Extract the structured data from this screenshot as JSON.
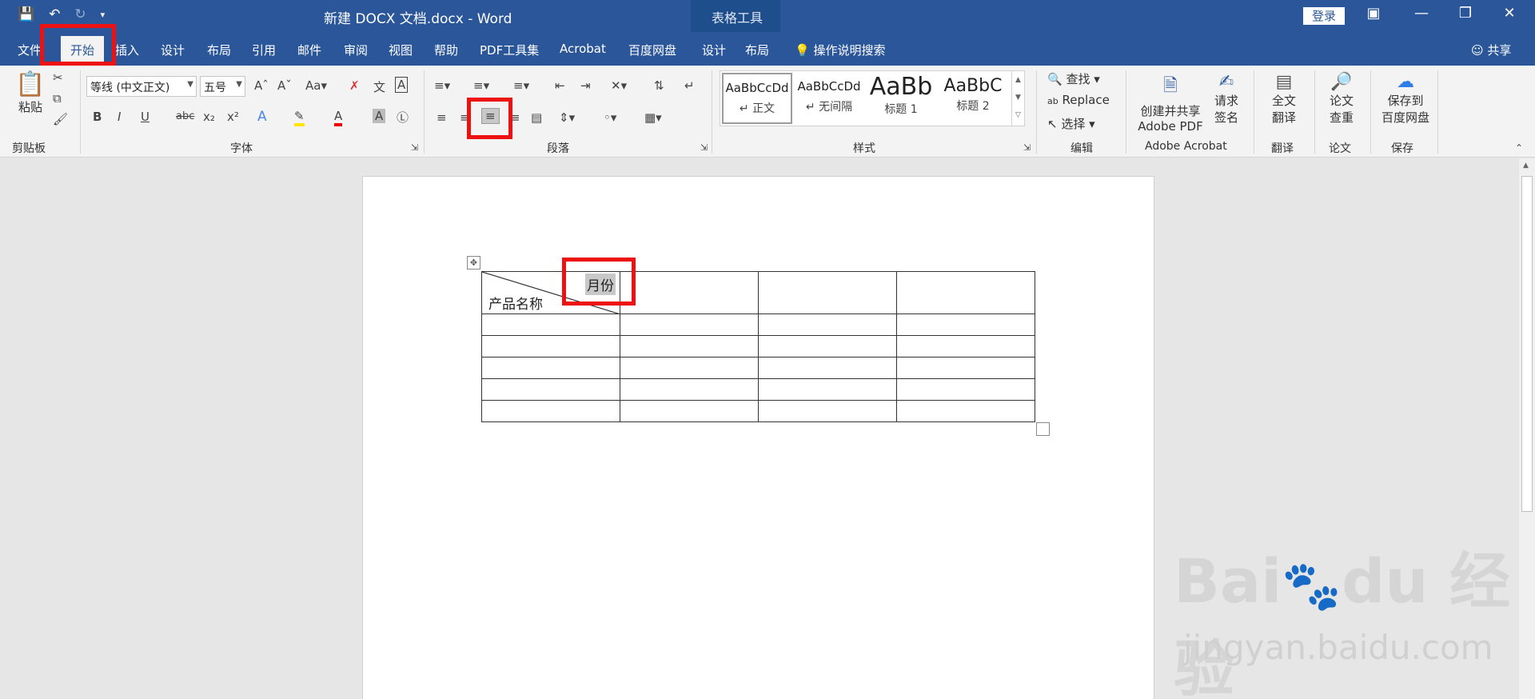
{
  "titlebar": {
    "document_title": "新建 DOCX 文档.docx  -  Word",
    "context_group": "表格工具",
    "login": "登录"
  },
  "tabs": [
    "文件",
    "开始",
    "插入",
    "设计",
    "布局",
    "引用",
    "邮件",
    "审阅",
    "视图",
    "帮助",
    "PDF工具集",
    "Acrobat",
    "百度网盘",
    "设计",
    "布局"
  ],
  "tell_me": "操作说明搜索",
  "share": "共享",
  "clipboard": {
    "paste": "粘贴",
    "label": "剪贴板"
  },
  "font": {
    "name": "等线 (中文正文)",
    "size": "五号",
    "label": "字体"
  },
  "paragraph": {
    "label": "段落"
  },
  "styles": {
    "label": "样式",
    "items": [
      {
        "sample": "AaBbCcDd",
        "name": "↵ 正文"
      },
      {
        "sample": "AaBbCcDd",
        "name": "↵ 无间隔"
      },
      {
        "sample": "AaBb",
        "name": "标题 1"
      },
      {
        "sample": "AaBbC",
        "name": "标题 2"
      }
    ]
  },
  "editing": {
    "find": "查找",
    "replace": "Replace",
    "select": "选择",
    "label": "编辑"
  },
  "acrobat": {
    "create": "创建并共享",
    "create2": "Adobe PDF",
    "sign": "请求",
    "sign2": "签名",
    "label": "Adobe Acrobat"
  },
  "translate": {
    "btn": "全文",
    "btn2": "翻译",
    "label": "翻译"
  },
  "thesis": {
    "btn": "论文",
    "btn2": "查重",
    "label": "论文"
  },
  "save": {
    "btn": "保存到",
    "btn2": "百度网盘",
    "label": "保存"
  },
  "table": {
    "header_top": "月份",
    "header_bottom": "产品名称"
  },
  "watermark": {
    "brand": "Bai du 经验",
    "url": "jingyan.baidu.com"
  },
  "colors": {
    "brand": "#2b579a",
    "highlight": "#e11111"
  }
}
